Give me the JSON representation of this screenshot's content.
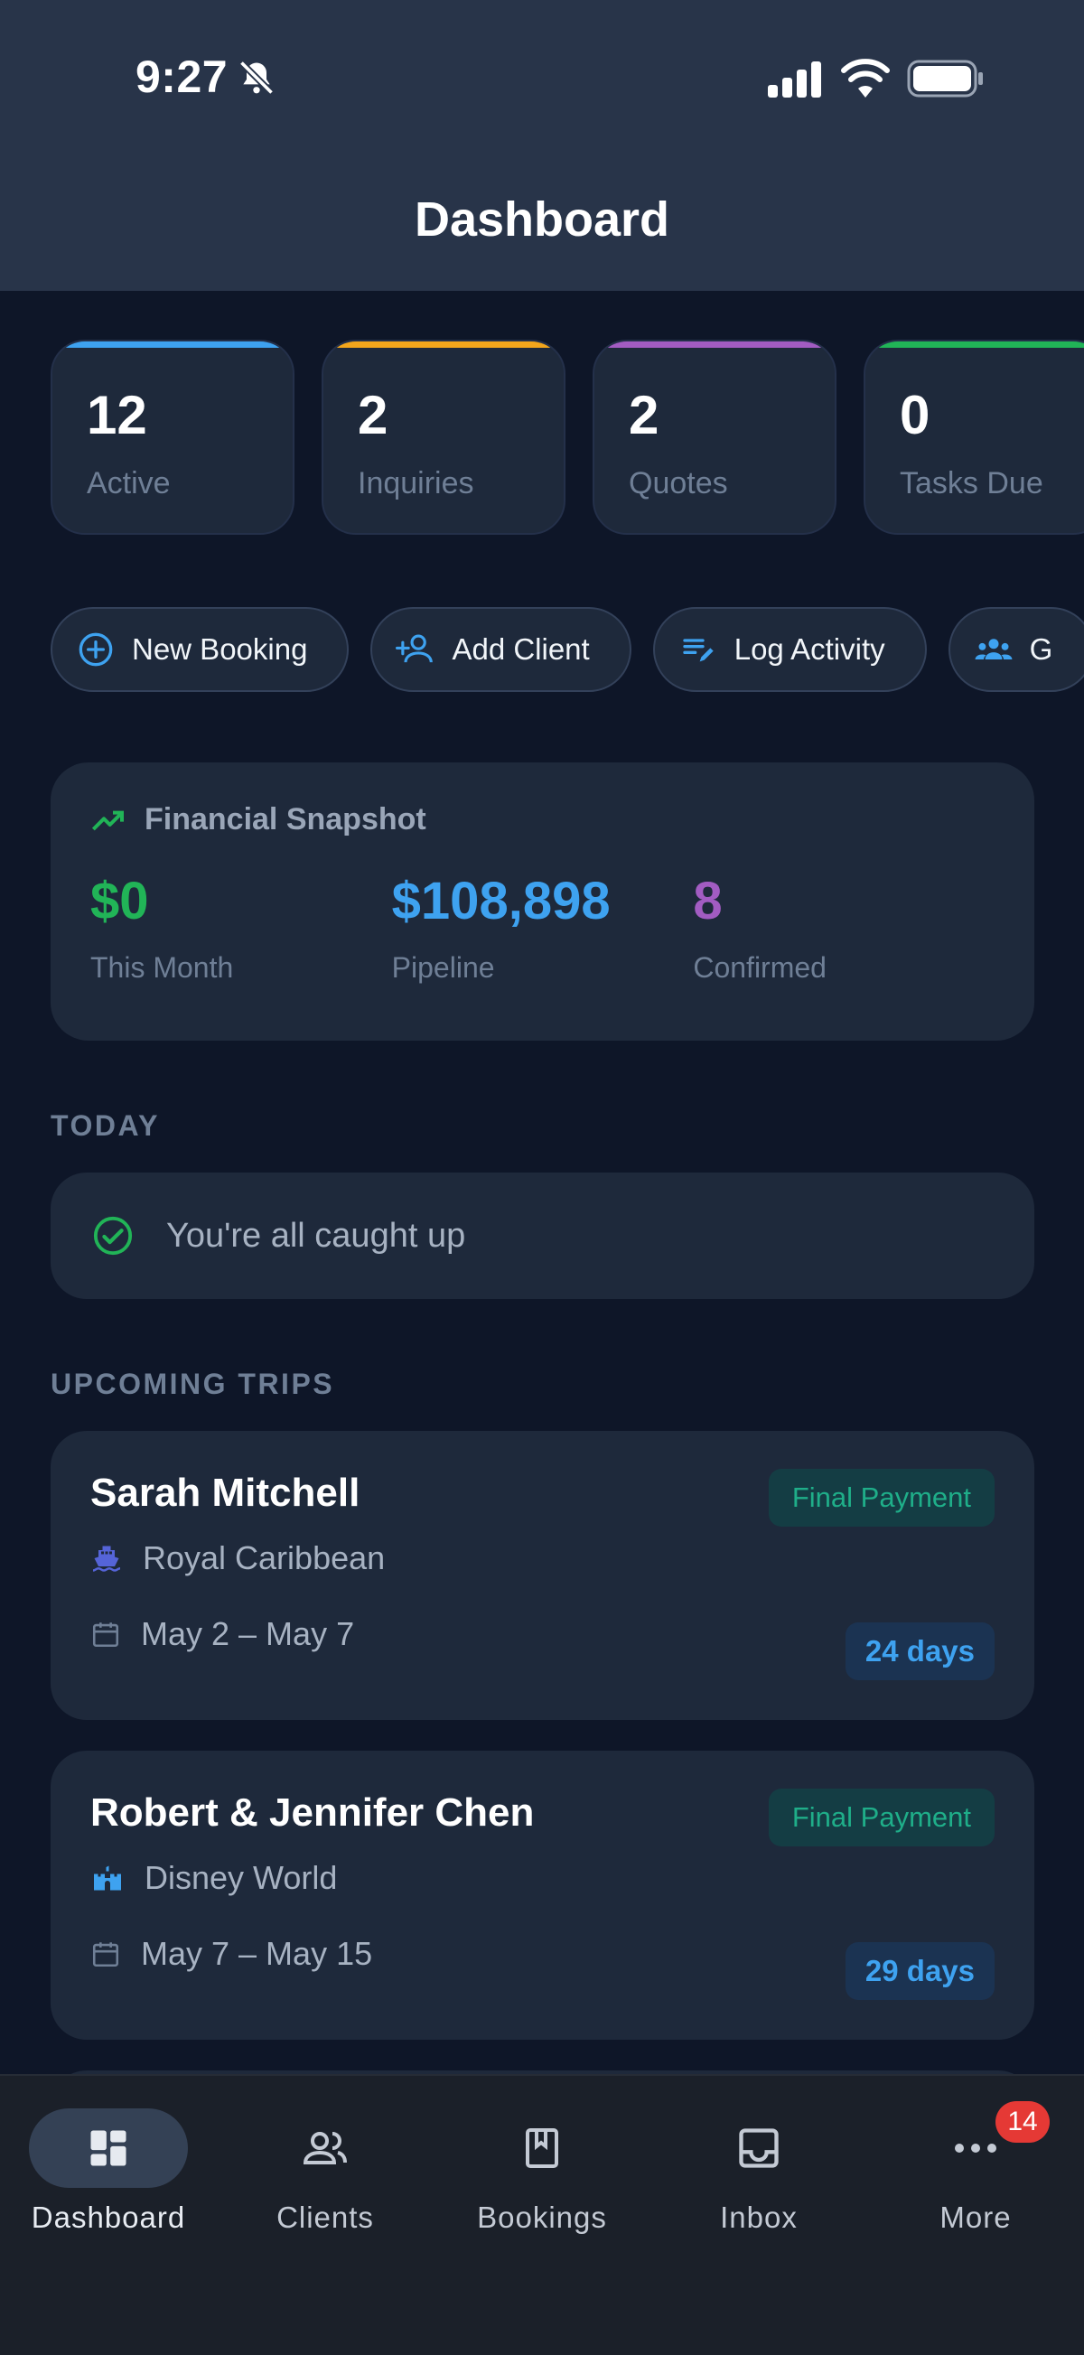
{
  "status_bar": {
    "time": "9:27"
  },
  "header": {
    "title": "Dashboard"
  },
  "stats": [
    {
      "value": "12",
      "label": "Active",
      "color": "#3ea2f0"
    },
    {
      "value": "2",
      "label": "Inquiries",
      "color": "#f2a51c"
    },
    {
      "value": "2",
      "label": "Quotes",
      "color": "#a25cc2"
    },
    {
      "value": "0",
      "label": "Tasks Due",
      "color": "#21b457"
    }
  ],
  "actions": [
    {
      "label": "New Booking",
      "icon": "plus-circle-icon"
    },
    {
      "label": "Add Client",
      "icon": "add-person-icon"
    },
    {
      "label": "Log Activity",
      "icon": "edit-note-icon"
    },
    {
      "label": "G",
      "icon": "group-icon"
    }
  ],
  "financial": {
    "title": "Financial Snapshot",
    "items": [
      {
        "value": "$0",
        "label": "This Month",
        "color": "#21b457"
      },
      {
        "value": "$108,898",
        "label": "Pipeline",
        "color": "#3ea2f0"
      },
      {
        "value": "8",
        "label": "Confirmed",
        "color": "#a25cc2"
      }
    ]
  },
  "today": {
    "section_label": "TODAY",
    "message": "You're all caught up"
  },
  "upcoming": {
    "section_label": "UPCOMING TRIPS",
    "trips": [
      {
        "name": "Sarah Mitchell",
        "badge": "Final Payment",
        "supplier": "Royal Caribbean",
        "supplier_icon": "ship-icon",
        "dates": "May 2 – May 7",
        "days": "24 days"
      },
      {
        "name": "Robert & Jennifer Chen",
        "badge": "Final Payment",
        "supplier": "Disney World",
        "supplier_icon": "castle-icon",
        "dates": "May 7 – May 15",
        "days": "29 days"
      }
    ]
  },
  "nav": {
    "items": [
      {
        "label": "Dashboard",
        "icon": "dashboard-icon",
        "active": true
      },
      {
        "label": "Clients",
        "icon": "people-icon"
      },
      {
        "label": "Bookings",
        "icon": "bookmark-book-icon"
      },
      {
        "label": "Inbox",
        "icon": "inbox-icon"
      },
      {
        "label": "More",
        "icon": "more-icon",
        "badge": "14"
      }
    ]
  }
}
